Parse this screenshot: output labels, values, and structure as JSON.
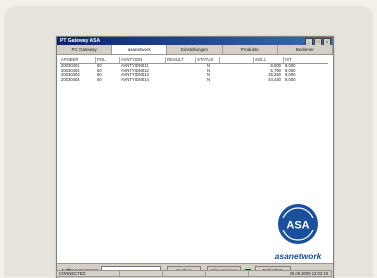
{
  "window": {
    "title": "PT Gateway ASA"
  },
  "tabs": [
    {
      "label": "PC Gateway",
      "active": false
    },
    {
      "label": "asanetwork",
      "active": true
    },
    {
      "label": "Einstellungen",
      "active": false
    },
    {
      "label": "Produkte",
      "active": false
    },
    {
      "label": "Bediener",
      "active": false
    }
  ],
  "grid": {
    "columns": [
      "AFNEER",
      "POL",
      "AVNTYIDN",
      "RESULT",
      "STATUS",
      "",
      "SOLL",
      "IST"
    ],
    "rows": [
      [
        "20030401",
        "50",
        "AVNTYIDN011",
        "",
        "N",
        "",
        "9,000",
        "8,000"
      ],
      [
        "20030402",
        "50",
        "AVNTYIDN012",
        "",
        "N",
        "",
        "5,790",
        "8,000"
      ],
      [
        "20030403",
        "50",
        "AVNTYIDN013",
        "",
        "N",
        "",
        "25,250",
        "8,000"
      ],
      [
        "20030404",
        "50",
        "AVNTYIDN014",
        "",
        "N",
        "",
        "44,440",
        "8,000"
      ]
    ]
  },
  "brand": {
    "name": "asanetwork",
    "logo_text": "ASA"
  },
  "bottom": {
    "auftrag_label": "Auftragsnummer",
    "search_value": "",
    "search_button": "Suchen",
    "all_button": "Alle anzeigen",
    "error_button": "Fehlerliste"
  },
  "status": {
    "left": "CONNECTED",
    "right": "26.08.2009  12:02:19"
  },
  "colors": {
    "title_bar": "#0a246a",
    "brand": "#1a4f9c",
    "led": "#19b319"
  }
}
